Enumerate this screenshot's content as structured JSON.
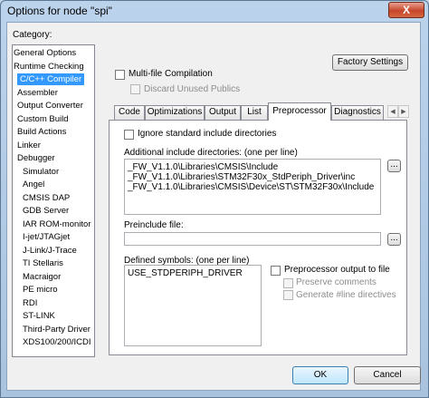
{
  "window": {
    "title": "Options for node \"spi\"",
    "close": "X"
  },
  "category": {
    "label": "Category:",
    "items": [
      {
        "label": "General Options",
        "indent": 0
      },
      {
        "label": "Runtime Checking",
        "indent": 0
      },
      {
        "label": "C/C++ Compiler",
        "indent": 1,
        "selected": true
      },
      {
        "label": "Assembler",
        "indent": 1
      },
      {
        "label": "Output Converter",
        "indent": 1
      },
      {
        "label": "Custom Build",
        "indent": 1
      },
      {
        "label": "Build Actions",
        "indent": 1
      },
      {
        "label": "Linker",
        "indent": 1
      },
      {
        "label": "Debugger",
        "indent": 1
      },
      {
        "label": "Simulator",
        "indent": 2
      },
      {
        "label": "Angel",
        "indent": 2
      },
      {
        "label": "CMSIS DAP",
        "indent": 2
      },
      {
        "label": "GDB Server",
        "indent": 2
      },
      {
        "label": "IAR ROM-monitor",
        "indent": 2
      },
      {
        "label": "I-jet/JTAGjet",
        "indent": 2
      },
      {
        "label": "J-Link/J-Trace",
        "indent": 2
      },
      {
        "label": "TI Stellaris",
        "indent": 2
      },
      {
        "label": "Macraigor",
        "indent": 2
      },
      {
        "label": "PE micro",
        "indent": 2
      },
      {
        "label": "RDI",
        "indent": 2
      },
      {
        "label": "ST-LINK",
        "indent": 2
      },
      {
        "label": "Third-Party Driver",
        "indent": 2
      },
      {
        "label": "XDS100/200/ICDI",
        "indent": 2
      }
    ]
  },
  "factory_settings": "Factory Settings",
  "multifile": {
    "label": "Multi-file Compilation",
    "checked": false
  },
  "discard": {
    "label": "Discard Unused Publics",
    "checked": false
  },
  "tabs": [
    {
      "label": "Code"
    },
    {
      "label": "Optimizations"
    },
    {
      "label": "Output"
    },
    {
      "label": "List"
    },
    {
      "label": "Preprocessor",
      "active": true
    },
    {
      "label": "Diagnostics"
    }
  ],
  "tab_scroll": {
    "left": "◀",
    "right": "▶"
  },
  "preprocessor": {
    "ignore_std": {
      "label": "Ignore standard include directories",
      "checked": false
    },
    "include_label": "Additional include directories: (one per line)",
    "include_lines": [
      "_FW_V1.1.0\\Libraries\\CMSIS\\Include",
      "_FW_V1.1.0\\Libraries\\STM32F30x_StdPeriph_Driver\\inc",
      "_FW_V1.1.0\\Libraries\\CMSIS\\Device\\ST\\STM32F30x\\Include"
    ],
    "browse": "...",
    "preinclude_label": "Preinclude file:",
    "preinclude_value": "",
    "defined_label": "Defined symbols: (one per line)",
    "defined_lines": [
      "USE_STDPERIPH_DRIVER"
    ],
    "pp_output": {
      "label": "Preprocessor output to file",
      "checked": false
    },
    "preserve": {
      "label": "Preserve comments",
      "checked": false
    },
    "generate": {
      "label": "Generate #line directives",
      "checked": false
    }
  },
  "ok": "OK",
  "cancel": "Cancel"
}
